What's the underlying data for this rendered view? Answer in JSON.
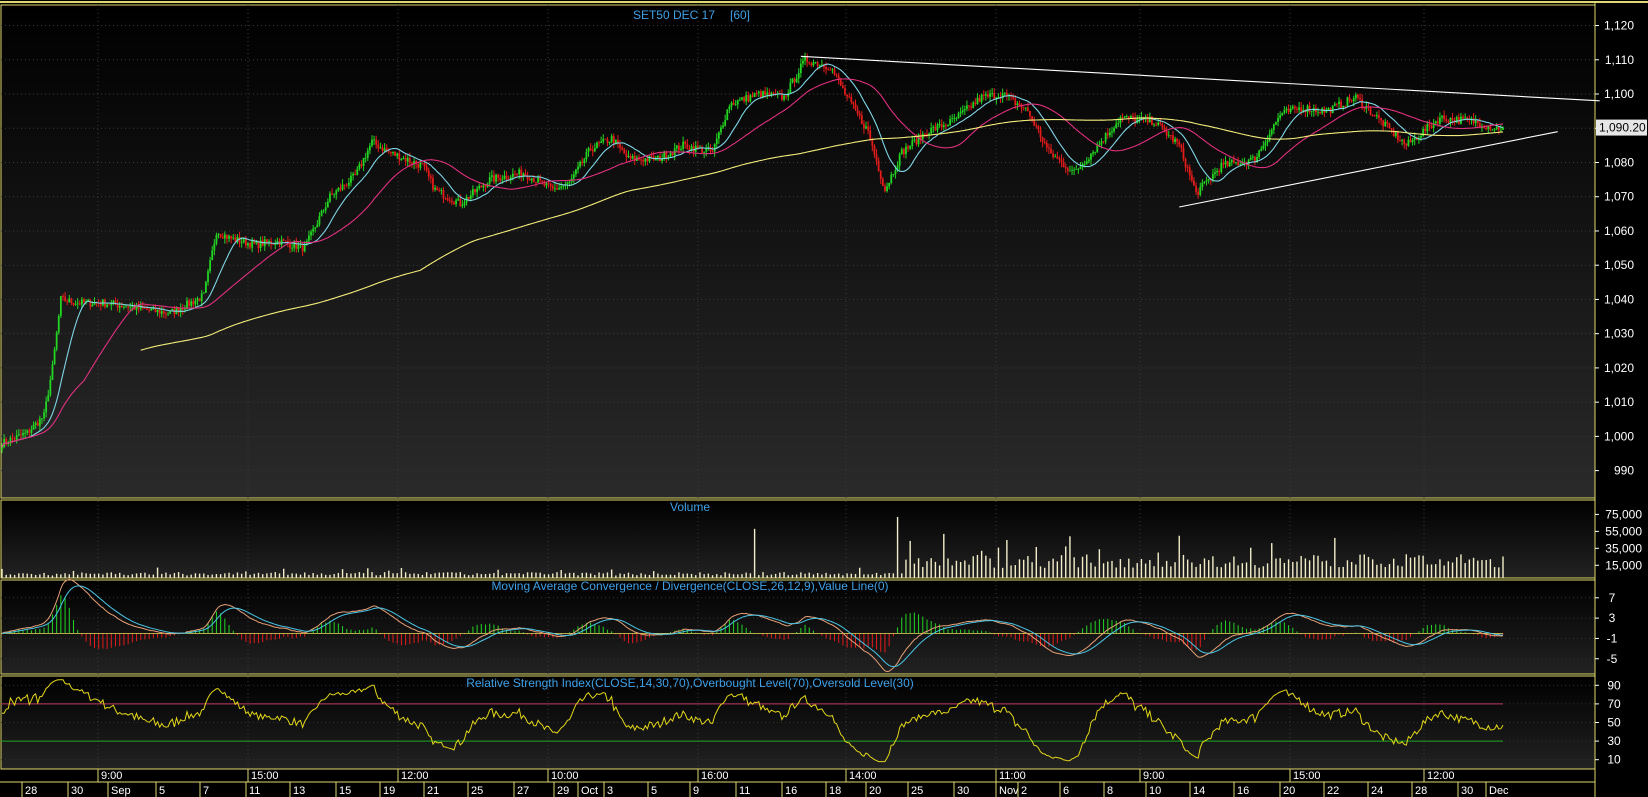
{
  "chart_data": [
    {
      "type": "candlestick",
      "title": "SET50 DEC 17",
      "interval_label": "[60]",
      "ylim": [
        982,
        1126
      ],
      "y_ticks": [
        "1,120",
        "1,110",
        "1,100",
        "1,090",
        "1,080",
        "1,070",
        "1,060",
        "1,050",
        "1,040",
        "1,030",
        "1,020",
        "1,010",
        "1,000",
        "990"
      ],
      "last_value": 1090.2,
      "last_value_label": "1,090.20",
      "price_anchors": [
        [
          0,
          998
        ],
        [
          12,
          1001
        ],
        [
          20,
          1006
        ],
        [
          24,
          1020
        ],
        [
          28,
          1040
        ],
        [
          36,
          1039
        ],
        [
          48,
          1039
        ],
        [
          60,
          1038
        ],
        [
          68,
          1037
        ],
        [
          80,
          1036
        ],
        [
          96,
          1041
        ],
        [
          102,
          1060
        ],
        [
          108,
          1058
        ],
        [
          120,
          1056
        ],
        [
          132,
          1057
        ],
        [
          144,
          1055
        ],
        [
          156,
          1070
        ],
        [
          168,
          1076
        ],
        [
          176,
          1086
        ],
        [
          184,
          1083
        ],
        [
          200,
          1079
        ],
        [
          206,
          1072
        ],
        [
          218,
          1068
        ],
        [
          232,
          1075
        ],
        [
          248,
          1077
        ],
        [
          262,
          1072
        ],
        [
          270,
          1074
        ],
        [
          280,
          1084
        ],
        [
          290,
          1087
        ],
        [
          298,
          1081
        ],
        [
          312,
          1081
        ],
        [
          324,
          1085
        ],
        [
          338,
          1083
        ],
        [
          346,
          1097
        ],
        [
          360,
          1100
        ],
        [
          372,
          1099
        ],
        [
          382,
          1110
        ],
        [
          394,
          1108
        ],
        [
          402,
          1099
        ],
        [
          412,
          1089
        ],
        [
          420,
          1072
        ],
        [
          428,
          1083
        ],
        [
          440,
          1089
        ],
        [
          452,
          1092
        ],
        [
          466,
          1099
        ],
        [
          476,
          1100
        ],
        [
          488,
          1095
        ],
        [
          498,
          1083
        ],
        [
          510,
          1077
        ],
        [
          520,
          1084
        ],
        [
          532,
          1093
        ],
        [
          548,
          1092
        ],
        [
          560,
          1085
        ],
        [
          568,
          1071
        ],
        [
          580,
          1079
        ],
        [
          596,
          1081
        ],
        [
          608,
          1094
        ],
        [
          618,
          1096
        ],
        [
          630,
          1095
        ],
        [
          644,
          1099
        ],
        [
          656,
          1092
        ],
        [
          668,
          1085
        ],
        [
          684,
          1093
        ],
        [
          700,
          1092
        ],
        [
          710,
          1090
        ],
        [
          714,
          1090.2
        ]
      ],
      "moving_averages": [
        {
          "color": "#7fd6e6",
          "period": 14
        },
        {
          "color": "#e0307f",
          "period": 40
        },
        {
          "color": "#f2ec7a",
          "period": 200
        }
      ],
      "trendlines": [
        {
          "from": [
            380,
            1111
          ],
          "to": [
            760,
            1098
          ]
        },
        {
          "from": [
            560,
            1067
          ],
          "to": [
            740,
            1089
          ]
        }
      ]
    },
    {
      "type": "bar",
      "title": "Volume",
      "y_ticks": [
        "75,000",
        "55,000",
        "35,000",
        "15,000"
      ],
      "ylim": [
        0,
        92000
      ]
    },
    {
      "type": "line",
      "title": "Moving Average Convergence / Divergence(CLOSE,26,12,9),Value Line(0)",
      "y_ticks": [
        "7",
        "3",
        "-1",
        "-5"
      ],
      "ylim": [
        -8,
        10.5
      ]
    },
    {
      "type": "line",
      "title": "Relative Strength Index(CLOSE,14,30,70),Overbought Level(70),Oversold Level(30)",
      "y_ticks": [
        "90",
        "70",
        "50",
        "30",
        "10"
      ],
      "ylim": [
        0,
        100
      ],
      "levels": [
        70,
        30
      ]
    }
  ],
  "x_axis": {
    "top_row": [
      "9:00",
      "15:00",
      "12:00",
      "10:00",
      "16:00",
      "14:00",
      "11:00",
      "9:00",
      "15:00",
      "12:00"
    ],
    "bottom_row": [
      "28",
      "30",
      "Sep",
      "5",
      "7",
      "11",
      "13",
      "15",
      "19",
      "21",
      "25",
      "27",
      "29",
      "Oct",
      "3",
      "5",
      "9",
      "11",
      "16",
      "18",
      "20",
      "25",
      "30",
      "Nov",
      "2",
      "6",
      "8",
      "10",
      "14",
      "16",
      "20",
      "22",
      "24",
      "28",
      "30",
      "Dec"
    ]
  },
  "colors": {
    "up": "#22d622",
    "down": "#e31b1b",
    "title": "#3fa0e6",
    "panel_border": "#e0d870",
    "trendline": "#ffffff",
    "ob_level": "#c03a62",
    "os_level": "#1ea81e",
    "rsi": "#e3d719",
    "macd": "#e6a078",
    "signal": "#49c6e6"
  }
}
